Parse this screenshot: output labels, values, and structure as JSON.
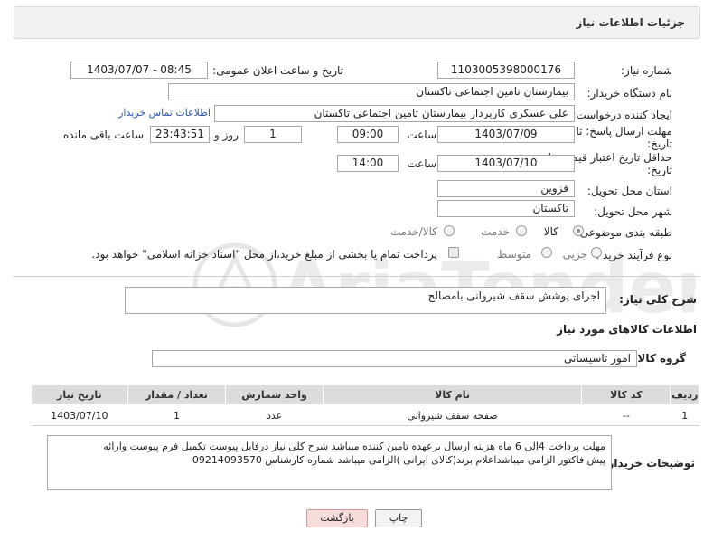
{
  "header": {
    "title": "جزئیات اطلاعات نیاز"
  },
  "fields": {
    "need_number_label": "شماره نیاز:",
    "need_number": "1103005398000176",
    "announce_label": "تاریخ و ساعت اعلان عمومی:",
    "announce_value": "1403/07/07 - 08:45",
    "buyer_org_label": "نام دستگاه خریدار:",
    "buyer_org": "بیمارستان تامین اجتماعی تاکستان",
    "requester_label": "ایجاد کننده درخواست:",
    "requester": "علی عسکری کارپرداز بیمارستان تامین اجتماعی تاکستان",
    "contact_link": "اطلاعات تماس خریدار",
    "deadline_label_1": "مهلت ارسال پاسخ: تا",
    "deadline_label_2": "تاریخ:",
    "deadline_date": "1403/07/09",
    "time_label": "ساعت",
    "deadline_time": "09:00",
    "days_value": "1",
    "days_label": "روز و",
    "remaining_time": "23:43:51",
    "remaining_label": "ساعت باقی مانده",
    "validity_label_1": "حداقل تاریخ اعتبار قیمت: تا",
    "validity_label_2": "تاریخ:",
    "validity_date": "1403/07/10",
    "validity_time": "14:00",
    "province_label": "استان محل تحویل:",
    "province": "قزوین",
    "city_label": "شهر محل تحویل:",
    "city": "تاکستان",
    "category_label": "طبقه بندی موضوعی:",
    "category_options": [
      "کالا",
      "خدمت",
      "کالا/خدمت"
    ],
    "category_selected": "کالا",
    "process_label": "نوع فرآیند خرید :",
    "process_options": [
      "جزیی",
      "متوسط"
    ],
    "payment_note": "پرداخت تمام یا بخشی از مبلغ خرید،از محل \"اسناد خزانه اسلامی\" خواهد بود."
  },
  "description": {
    "label": "شرح کلی نیاز:",
    "value": "اجرای پوشش سقف شیروانی بامصالح"
  },
  "goods_info_title": "اطلاعات کالاهای مورد نیاز",
  "goods_group": {
    "label": "گروه کالا:",
    "value": "امور تاسیساتی"
  },
  "table": {
    "headers": [
      "ردیف",
      "کد کالا",
      "نام کالا",
      "واحد شمارش",
      "تعداد / مقدار",
      "تاریخ نیاز"
    ],
    "rows": [
      [
        "1",
        "--",
        "صفحه سقف شیروانی",
        "عدد",
        "1",
        "1403/07/10"
      ]
    ]
  },
  "buyer_notes": {
    "label": "توضیحات خریدار:",
    "line1": "مهلت پرداخت 4الی 6 ماه هزینه ارسال برعهده تامین کننده میباشد شرح کلی نیاز درفایل پیوست تکمیل فرم پیوست وارائه",
    "line2": "پیش فاکتور الزامی میباشداعلام برند(کالای ایرانی )الزامی میباشد شماره کارشناس 09214093570"
  },
  "buttons": {
    "print": "چاپ",
    "back": "بازگشت"
  },
  "watermark": "AriaTender.neT"
}
